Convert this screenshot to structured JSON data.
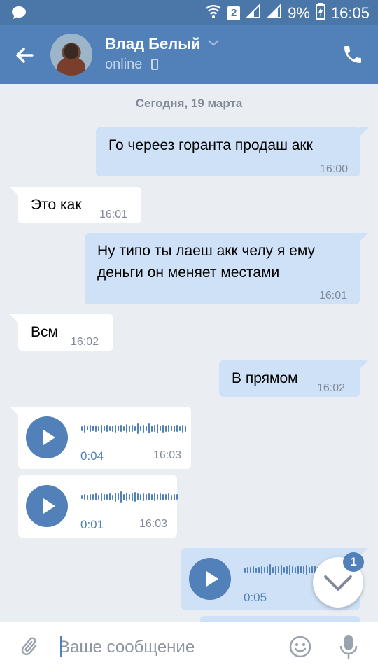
{
  "status_bar": {
    "sim": "2",
    "battery": "9%",
    "time": "16:05"
  },
  "header": {
    "name": "Влад Белый",
    "status": "online"
  },
  "date_separator": "Сегодня, 19 марта",
  "messages": {
    "m1": {
      "text": "Го череез горанта продаш акк",
      "time": "16:00"
    },
    "m2": {
      "text": "Это как",
      "time": "16:01"
    },
    "m3": {
      "line1": "Ну типо ты лаеш акк челу я ему",
      "line2": "деньги он меняет местами",
      "time": "16:01"
    },
    "m4": {
      "text": "Всм",
      "time": "16:02"
    },
    "m5": {
      "text": "В прямом",
      "time": "16:02"
    },
    "v1": {
      "duration": "0:04",
      "time": "16:03"
    },
    "v2": {
      "duration": "0:01",
      "time": "16:03"
    },
    "v3": {
      "duration": "0:05"
    }
  },
  "scroll_down": {
    "unread_count": "1"
  },
  "compose": {
    "placeholder": "Ваше сообщение"
  },
  "colors": {
    "header": "#5181b8",
    "status_bar": "#4a76a8",
    "outgoing_bubble": "#cfe1f7",
    "incoming_bubble": "#ffffff",
    "background": "#eaeef2",
    "accent": "#5181b8"
  },
  "icons": [
    "chat-notification-icon",
    "wifi-icon",
    "signal-icon",
    "battery-icon",
    "back-arrow-icon",
    "chevron-down-icon",
    "phone-status-icon",
    "phone-call-icon",
    "play-icon",
    "waveform-icon",
    "chevron-down-icon",
    "paperclip-icon",
    "smiley-icon",
    "microphone-icon"
  ]
}
